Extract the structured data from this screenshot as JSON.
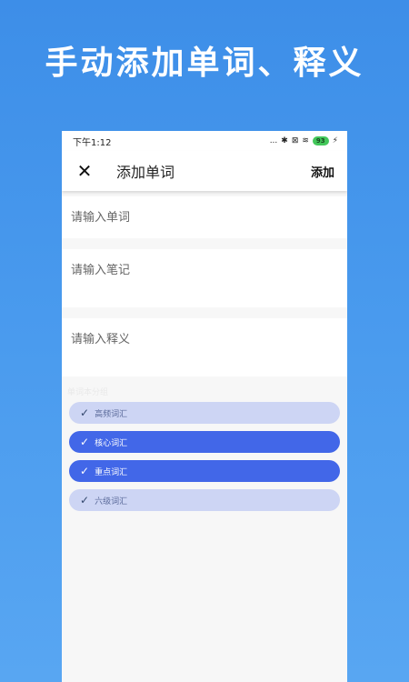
{
  "headline": "手动添加单词、释义",
  "statusbar": {
    "time": "下午1:12",
    "dots": "...",
    "bluetooth": "✱",
    "sim": "⊠",
    "wifi": "≋",
    "battery": "93",
    "charging": "⚡"
  },
  "appbar": {
    "close_icon": "✕",
    "title": "添加单词",
    "add_label": "添加"
  },
  "form": {
    "word_placeholder": "请输入单词",
    "note_placeholder": "请输入笔记",
    "meaning_placeholder": "请输入释义"
  },
  "section_label": "单词本分组",
  "tags": [
    {
      "label": "高频词汇",
      "selected": false
    },
    {
      "label": "核心词汇",
      "selected": true
    },
    {
      "label": "重点词汇",
      "selected": true
    },
    {
      "label": "六级词汇",
      "selected": false
    }
  ],
  "check_icon": "✓",
  "colors": {
    "background": "#4a9bee",
    "tag_selected": "#4267e8",
    "tag_unselected": "#cdd5f4"
  }
}
